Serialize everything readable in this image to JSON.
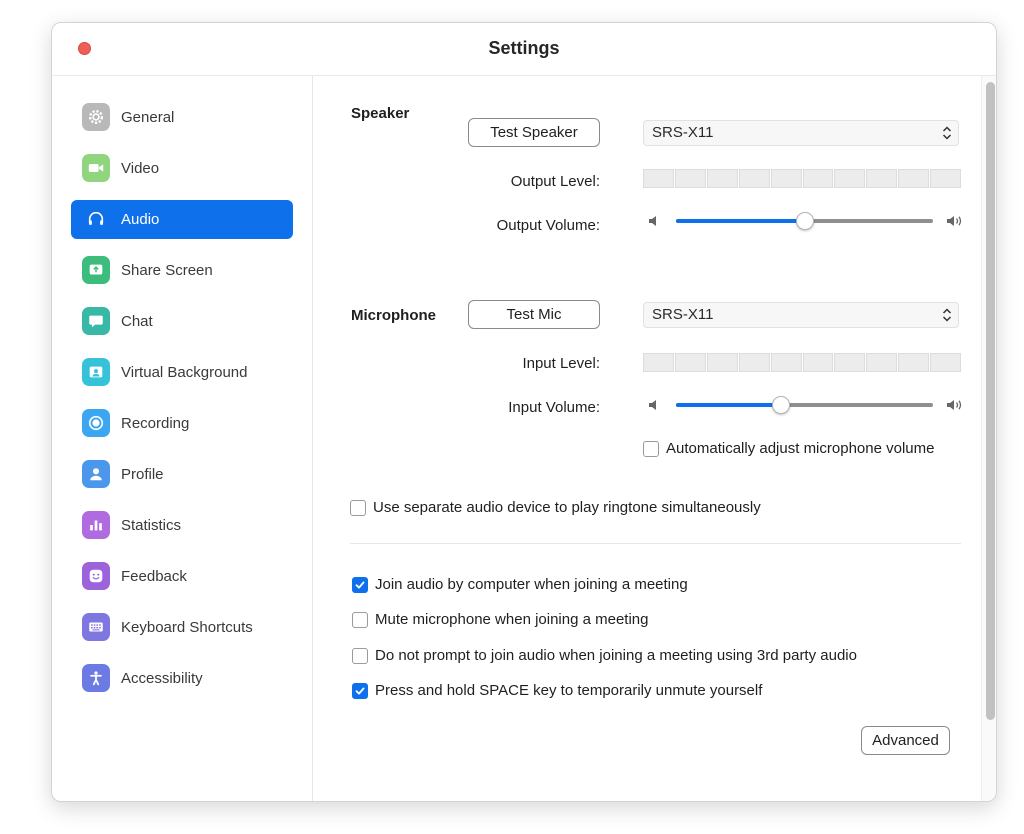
{
  "window": {
    "title": "Settings"
  },
  "sidebar": {
    "items": [
      {
        "label": "General",
        "icon": "gear-icon",
        "color": "#b8b8b8",
        "active": false
      },
      {
        "label": "Video",
        "icon": "video-camera-icon",
        "color": "#8ed57e",
        "active": false
      },
      {
        "label": "Audio",
        "icon": "headphones-icon",
        "color": "#0e71eb",
        "active": true
      },
      {
        "label": "Share Screen",
        "icon": "share-screen-icon",
        "color": "#3dbd7d",
        "active": false
      },
      {
        "label": "Chat",
        "icon": "chat-bubble-icon",
        "color": "#39b8a5",
        "active": false
      },
      {
        "label": "Virtual Background",
        "icon": "virtual-background-icon",
        "color": "#36c3d9",
        "active": false
      },
      {
        "label": "Recording",
        "icon": "recording-icon",
        "color": "#3aa7f0",
        "active": false
      },
      {
        "label": "Profile",
        "icon": "profile-icon",
        "color": "#4b97ec",
        "active": false
      },
      {
        "label": "Statistics",
        "icon": "statistics-icon",
        "color": "#b06be0",
        "active": false
      },
      {
        "label": "Feedback",
        "icon": "feedback-smile-icon",
        "color": "#9b63dc",
        "active": false
      },
      {
        "label": "Keyboard Shortcuts",
        "icon": "keyboard-icon",
        "color": "#7f77e0",
        "active": false
      },
      {
        "label": "Accessibility",
        "icon": "accessibility-icon",
        "color": "#6c7be3",
        "active": false
      }
    ]
  },
  "speaker": {
    "label": "Speaker",
    "test_button": "Test Speaker",
    "device": "SRS-X11",
    "output_level_label": "Output Level:",
    "output_volume_label": "Output Volume:",
    "output_volume_fraction": 0.5
  },
  "microphone": {
    "label": "Microphone",
    "test_button": "Test Mic",
    "device": "SRS-X11",
    "input_level_label": "Input Level:",
    "input_volume_label": "Input Volume:",
    "input_volume_fraction": 0.41,
    "auto_adjust": {
      "label": "Automatically adjust microphone volume",
      "checked": false
    }
  },
  "options": {
    "separate_device": {
      "label": "Use separate audio device to play ringtone simultaneously",
      "checked": false
    },
    "join_by_computer": {
      "label": "Join audio by computer when joining a meeting",
      "checked": true
    },
    "mute_on_join": {
      "label": "Mute microphone when joining a meeting",
      "checked": false
    },
    "no_prompt_3rd_party": {
      "label": "Do not prompt to join audio when joining a meeting using 3rd party audio",
      "checked": false
    },
    "space_to_unmute": {
      "label": "Press and hold SPACE key to temporarily unmute yourself",
      "checked": true
    }
  },
  "advanced_button": "Advanced",
  "colors": {
    "accent": "#0e71eb",
    "close": "#ed5f57"
  }
}
